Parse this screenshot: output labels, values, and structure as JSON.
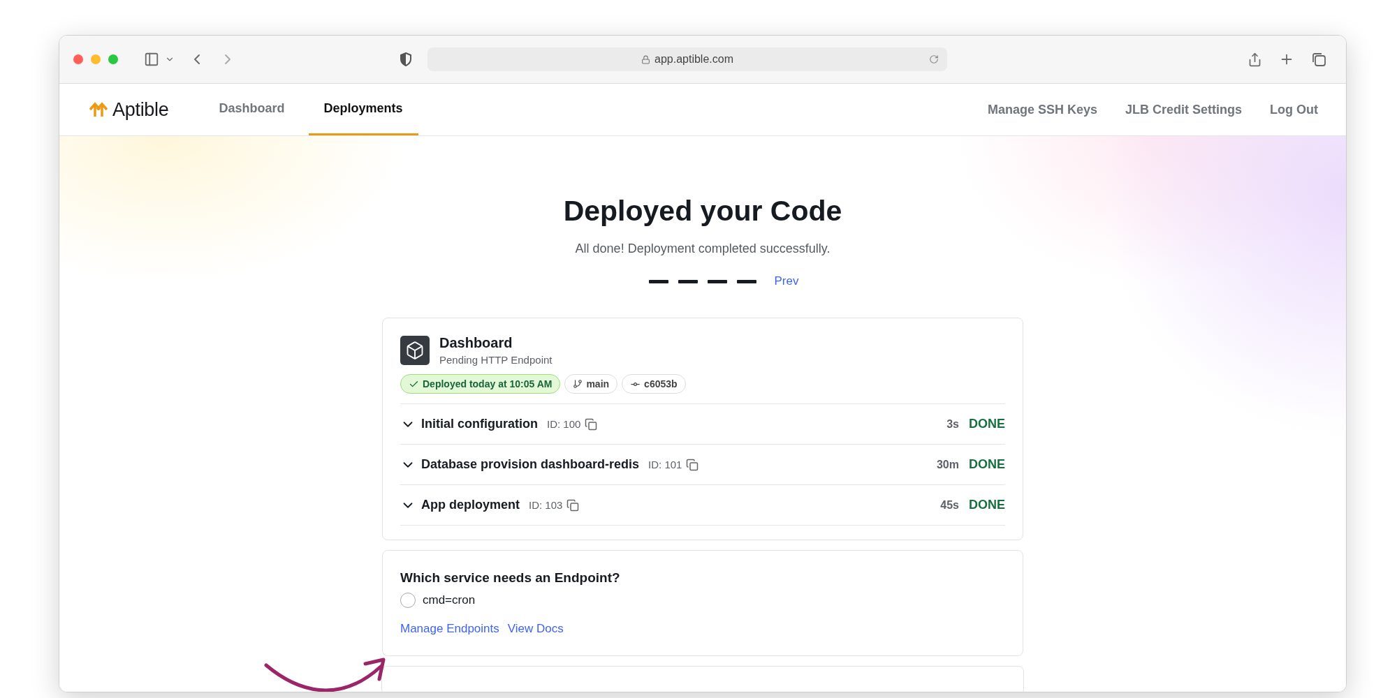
{
  "browser": {
    "url": "app.aptible.com"
  },
  "nav": {
    "logo": "Aptible",
    "tabs": [
      {
        "label": "Dashboard",
        "selected": false
      },
      {
        "label": "Deployments",
        "selected": true
      }
    ],
    "links": [
      "Manage SSH Keys",
      "JLB Credit Settings",
      "Log Out"
    ]
  },
  "hero": {
    "title": "Deployed your Code",
    "subtitle": "All done! Deployment completed successfully.",
    "steps": [
      {
        "completed": true
      },
      {
        "completed": true
      },
      {
        "completed": true
      },
      {
        "completed": true
      }
    ],
    "prev": "Prev"
  },
  "app_card": {
    "name": "Dashboard",
    "status": "Pending HTTP Endpoint",
    "badges": [
      {
        "kind": "success",
        "label": "Deployed today at 10:05 AM"
      },
      {
        "kind": "branch",
        "label": "main"
      },
      {
        "kind": "commit",
        "label": "c6053b"
      }
    ],
    "operations": [
      {
        "name": "Initial configuration",
        "id": "ID: 100",
        "duration": "3s",
        "status": "DONE"
      },
      {
        "name": "Database provision dashboard-redis",
        "id": "ID: 101",
        "duration": "30m",
        "status": "DONE"
      },
      {
        "name": "App deployment",
        "id": "ID: 103",
        "duration": "45s",
        "status": "DONE"
      }
    ]
  },
  "endpoint_card": {
    "question": "Which service needs an Endpoint?",
    "services": [
      {
        "label": "cmd=cron",
        "selected": false
      }
    ],
    "links": [
      "Manage Endpoints",
      "View Docs"
    ]
  }
}
